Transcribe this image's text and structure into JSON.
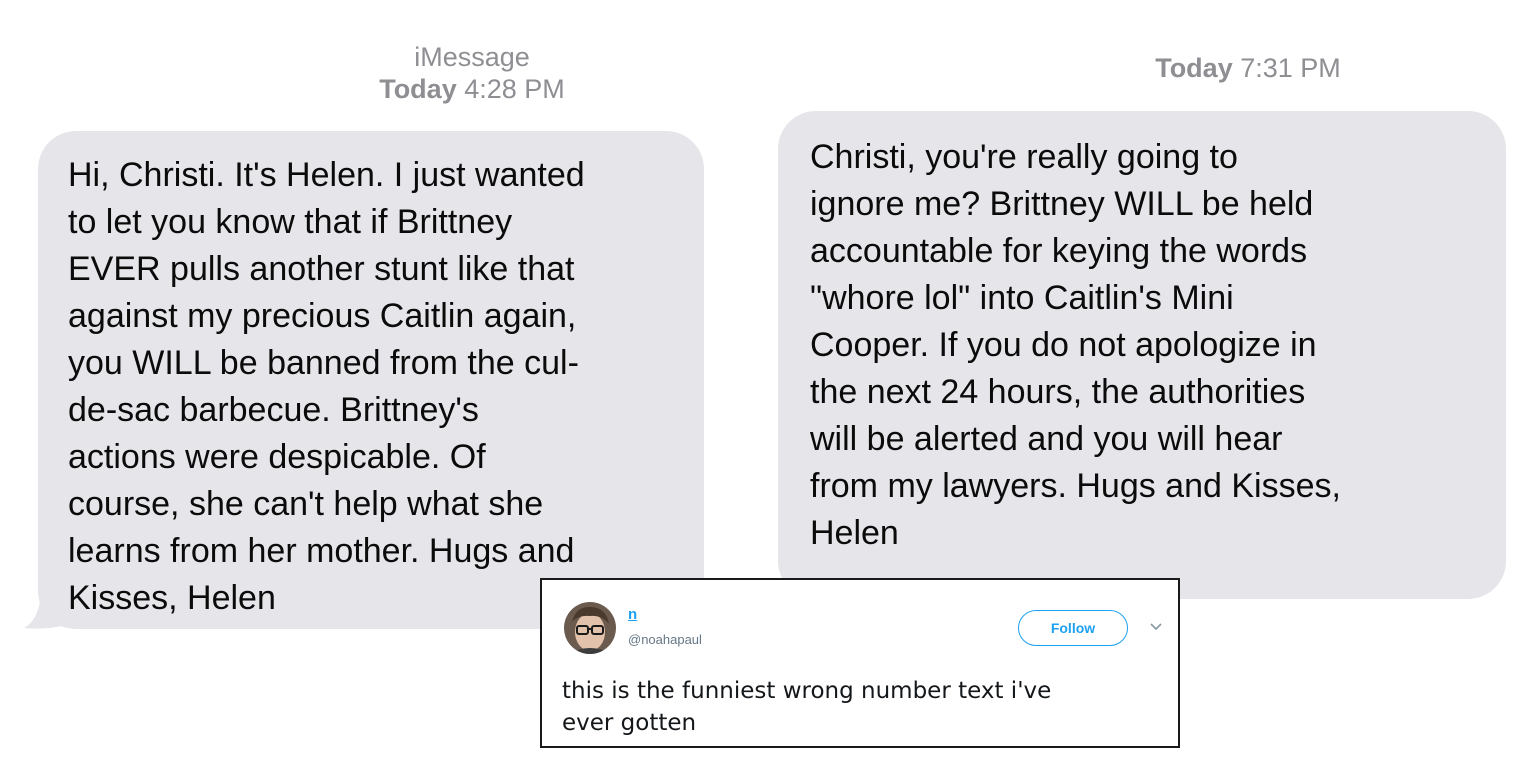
{
  "left_thread": {
    "service": "iMessage",
    "day": "Today",
    "time": "4:28 PM",
    "lines": [
      "Hi, Christi. It's Helen. I just wanted",
      "to let you know that if Brittney",
      "EVER pulls another stunt like that",
      "against my precious Caitlin again,",
      "you WILL be banned from the cul-",
      "de-sac barbecue. Brittney's",
      "actions were despicable. Of",
      "course, she can't help what she",
      "learns from her mother. Hugs and",
      "Kisses, Helen"
    ]
  },
  "right_thread": {
    "day": "Today",
    "time": "7:31 PM",
    "lines": [
      "Christi, you're really going to",
      "ignore me? Brittney WILL be held",
      "accountable for keying the words",
      "\"whore lol\" into Caitlin's Mini",
      "Cooper. If you do not apologize in",
      "the next 24 hours, the authorities",
      "will be alerted and you will hear",
      "from my lawyers. Hugs and Kisses,",
      "Helen"
    ]
  },
  "tweet": {
    "display_name": "n",
    "handle": "@noahapaul",
    "follow_label": "Follow",
    "lines": [
      "this is the funniest wrong number text i've",
      "ever gotten"
    ]
  },
  "colors": {
    "bubble_gray": "#e5e5ea",
    "timestamp_gray": "#8e8e93",
    "twitter_blue": "#1da1f2",
    "handle_gray": "#657786"
  },
  "icons": {
    "avatar": "avatar-photo",
    "menu": "chevron-down-icon"
  }
}
